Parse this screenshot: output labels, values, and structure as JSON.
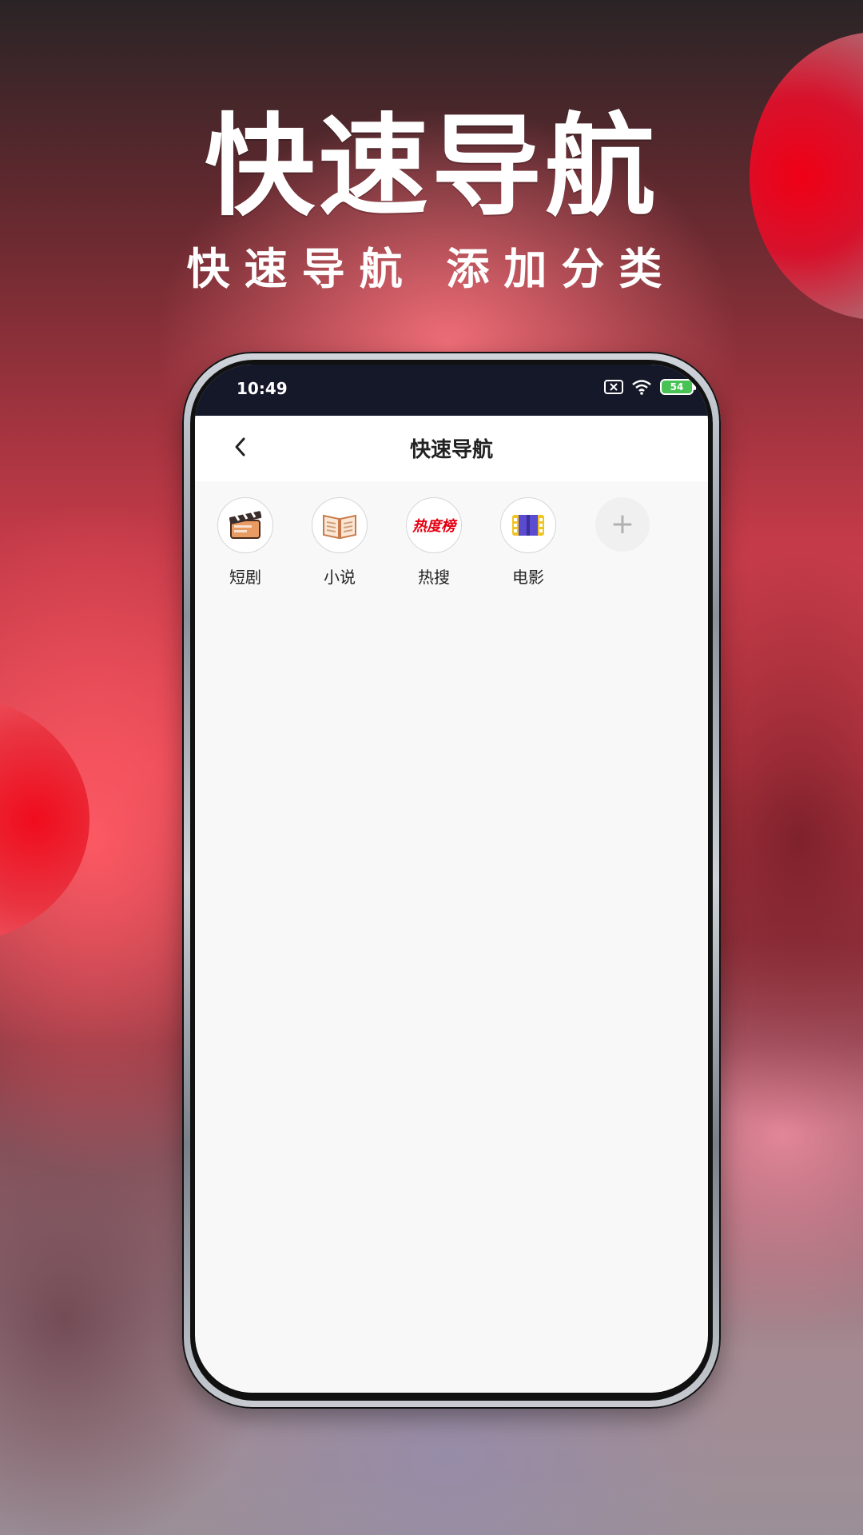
{
  "hero": {
    "title": "快速导航",
    "subtitle": "快速导航 添加分类"
  },
  "status_bar": {
    "time": "10:49",
    "battery": "54",
    "icons": [
      "close-icon",
      "wifi-icon",
      "battery-icon"
    ]
  },
  "app_bar": {
    "title": "快速导航",
    "back_icon": "back-icon"
  },
  "nav_items": [
    {
      "label": "短剧",
      "icon": "clapperboard-icon"
    },
    {
      "label": "小说",
      "icon": "open-book-icon"
    },
    {
      "label": "热搜",
      "icon": "hot-list-icon",
      "icon_text": "热度榜"
    },
    {
      "label": "电影",
      "icon": "film-icon"
    }
  ],
  "add_item": {
    "icon": "plus-icon",
    "symbol": "+"
  },
  "colors": {
    "accent_red": "#e60012",
    "status_bar": "#141828",
    "screen_bg": "#f8f8f8"
  }
}
